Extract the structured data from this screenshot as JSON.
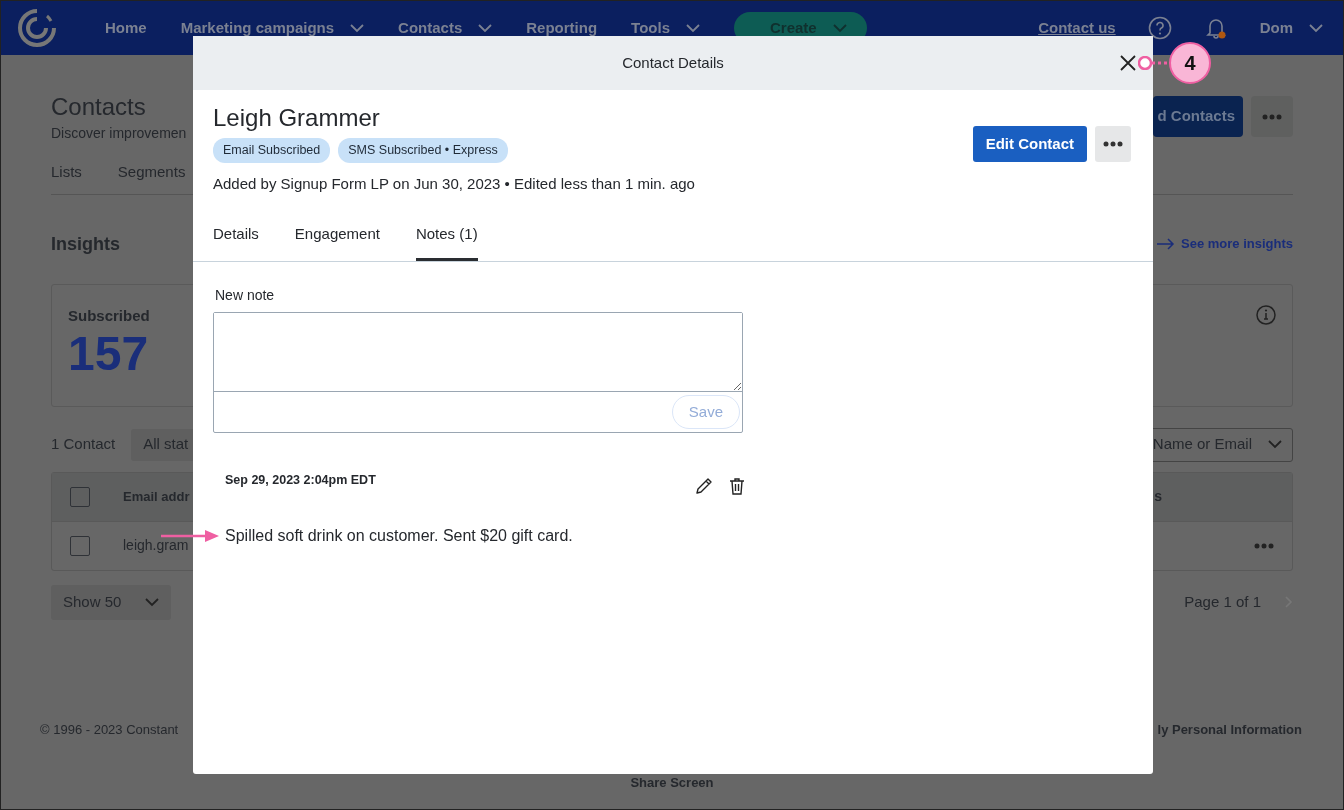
{
  "navbar": {
    "items": [
      {
        "label": "Home",
        "dropdown": false
      },
      {
        "label": "Marketing campaigns",
        "dropdown": true
      },
      {
        "label": "Contacts",
        "dropdown": true
      },
      {
        "label": "Reporting",
        "dropdown": false
      },
      {
        "label": "Tools",
        "dropdown": true
      }
    ],
    "create_button": "Create",
    "contact_link": "Contact us",
    "user": "Dom",
    "notification": true
  },
  "page": {
    "title": "Contacts",
    "subtitle": "Discover improvemen",
    "tabs": [
      "Lists",
      "Segments"
    ],
    "add_button": "d Contacts",
    "insights_title": "Insights",
    "insights_link": "See more insights",
    "stat_label": "Subscribed",
    "stat_value": "157",
    "count": "1 Contact",
    "status_filter": "All stat",
    "search_filter": "Name or Email",
    "table": {
      "header_checked": false,
      "columns": [
        "Email addr",
        "s"
      ],
      "rows": [
        {
          "cells": [
            "leigh.gram"
          ],
          "checked": false
        }
      ]
    },
    "page_size": "Show 50",
    "pagination": "Page 1 of 1",
    "footer_left": "© 1996 - 2023 Constant",
    "footer_right": "ly Personal Information",
    "share": "Share Screen"
  },
  "modal": {
    "title": "Contact Details",
    "name": "Leigh Grammer",
    "badges": [
      "Email Subscribed",
      "SMS Subscribed • Express"
    ],
    "meta": "Added by Signup Form LP on Jun 30, 2023 • Edited less than 1 min. ago",
    "edit_button": "Edit Contact",
    "tabs": [
      {
        "label": "Details",
        "selected": false
      },
      {
        "label": "Engagement",
        "selected": false
      },
      {
        "label": "Notes (1)",
        "selected": true
      }
    ],
    "note_label": "New note",
    "save_button": {
      "label": "Save",
      "disabled": true
    },
    "notes": [
      {
        "date": "Sep 29, 2023 2:04pm EDT",
        "text": "Spilled soft drink on customer. Sent $20 gift card."
      }
    ]
  },
  "annotations": {
    "callout": "4"
  }
}
